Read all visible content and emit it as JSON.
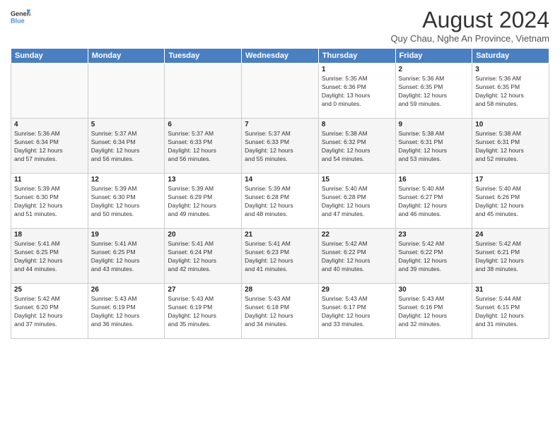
{
  "header": {
    "logo_line1": "General",
    "logo_line2": "Blue",
    "month_title": "August 2024",
    "subtitle": "Quy Chau, Nghe An Province, Vietnam"
  },
  "weekdays": [
    "Sunday",
    "Monday",
    "Tuesday",
    "Wednesday",
    "Thursday",
    "Friday",
    "Saturday"
  ],
  "weeks": [
    [
      {
        "day": "",
        "info": ""
      },
      {
        "day": "",
        "info": ""
      },
      {
        "day": "",
        "info": ""
      },
      {
        "day": "",
        "info": ""
      },
      {
        "day": "1",
        "info": "Sunrise: 5:35 AM\nSunset: 6:36 PM\nDaylight: 13 hours\nand 0 minutes."
      },
      {
        "day": "2",
        "info": "Sunrise: 5:36 AM\nSunset: 6:35 PM\nDaylight: 12 hours\nand 59 minutes."
      },
      {
        "day": "3",
        "info": "Sunrise: 5:36 AM\nSunset: 6:35 PM\nDaylight: 12 hours\nand 58 minutes."
      }
    ],
    [
      {
        "day": "4",
        "info": "Sunrise: 5:36 AM\nSunset: 6:34 PM\nDaylight: 12 hours\nand 57 minutes."
      },
      {
        "day": "5",
        "info": "Sunrise: 5:37 AM\nSunset: 6:34 PM\nDaylight: 12 hours\nand 56 minutes."
      },
      {
        "day": "6",
        "info": "Sunrise: 5:37 AM\nSunset: 6:33 PM\nDaylight: 12 hours\nand 56 minutes."
      },
      {
        "day": "7",
        "info": "Sunrise: 5:37 AM\nSunset: 6:33 PM\nDaylight: 12 hours\nand 55 minutes."
      },
      {
        "day": "8",
        "info": "Sunrise: 5:38 AM\nSunset: 6:32 PM\nDaylight: 12 hours\nand 54 minutes."
      },
      {
        "day": "9",
        "info": "Sunrise: 5:38 AM\nSunset: 6:31 PM\nDaylight: 12 hours\nand 53 minutes."
      },
      {
        "day": "10",
        "info": "Sunrise: 5:38 AM\nSunset: 6:31 PM\nDaylight: 12 hours\nand 52 minutes."
      }
    ],
    [
      {
        "day": "11",
        "info": "Sunrise: 5:39 AM\nSunset: 6:30 PM\nDaylight: 12 hours\nand 51 minutes."
      },
      {
        "day": "12",
        "info": "Sunrise: 5:39 AM\nSunset: 6:30 PM\nDaylight: 12 hours\nand 50 minutes."
      },
      {
        "day": "13",
        "info": "Sunrise: 5:39 AM\nSunset: 6:29 PM\nDaylight: 12 hours\nand 49 minutes."
      },
      {
        "day": "14",
        "info": "Sunrise: 5:39 AM\nSunset: 6:28 PM\nDaylight: 12 hours\nand 48 minutes."
      },
      {
        "day": "15",
        "info": "Sunrise: 5:40 AM\nSunset: 6:28 PM\nDaylight: 12 hours\nand 47 minutes."
      },
      {
        "day": "16",
        "info": "Sunrise: 5:40 AM\nSunset: 6:27 PM\nDaylight: 12 hours\nand 46 minutes."
      },
      {
        "day": "17",
        "info": "Sunrise: 5:40 AM\nSunset: 6:26 PM\nDaylight: 12 hours\nand 45 minutes."
      }
    ],
    [
      {
        "day": "18",
        "info": "Sunrise: 5:41 AM\nSunset: 6:25 PM\nDaylight: 12 hours\nand 44 minutes."
      },
      {
        "day": "19",
        "info": "Sunrise: 5:41 AM\nSunset: 6:25 PM\nDaylight: 12 hours\nand 43 minutes."
      },
      {
        "day": "20",
        "info": "Sunrise: 5:41 AM\nSunset: 6:24 PM\nDaylight: 12 hours\nand 42 minutes."
      },
      {
        "day": "21",
        "info": "Sunrise: 5:41 AM\nSunset: 6:23 PM\nDaylight: 12 hours\nand 41 minutes."
      },
      {
        "day": "22",
        "info": "Sunrise: 5:42 AM\nSunset: 6:22 PM\nDaylight: 12 hours\nand 40 minutes."
      },
      {
        "day": "23",
        "info": "Sunrise: 5:42 AM\nSunset: 6:22 PM\nDaylight: 12 hours\nand 39 minutes."
      },
      {
        "day": "24",
        "info": "Sunrise: 5:42 AM\nSunset: 6:21 PM\nDaylight: 12 hours\nand 38 minutes."
      }
    ],
    [
      {
        "day": "25",
        "info": "Sunrise: 5:42 AM\nSunset: 6:20 PM\nDaylight: 12 hours\nand 37 minutes."
      },
      {
        "day": "26",
        "info": "Sunrise: 5:43 AM\nSunset: 6:19 PM\nDaylight: 12 hours\nand 36 minutes."
      },
      {
        "day": "27",
        "info": "Sunrise: 5:43 AM\nSunset: 6:19 PM\nDaylight: 12 hours\nand 35 minutes."
      },
      {
        "day": "28",
        "info": "Sunrise: 5:43 AM\nSunset: 6:18 PM\nDaylight: 12 hours\nand 34 minutes."
      },
      {
        "day": "29",
        "info": "Sunrise: 5:43 AM\nSunset: 6:17 PM\nDaylight: 12 hours\nand 33 minutes."
      },
      {
        "day": "30",
        "info": "Sunrise: 5:43 AM\nSunset: 6:16 PM\nDaylight: 12 hours\nand 32 minutes."
      },
      {
        "day": "31",
        "info": "Sunrise: 5:44 AM\nSunset: 6:15 PM\nDaylight: 12 hours\nand 31 minutes."
      }
    ]
  ]
}
